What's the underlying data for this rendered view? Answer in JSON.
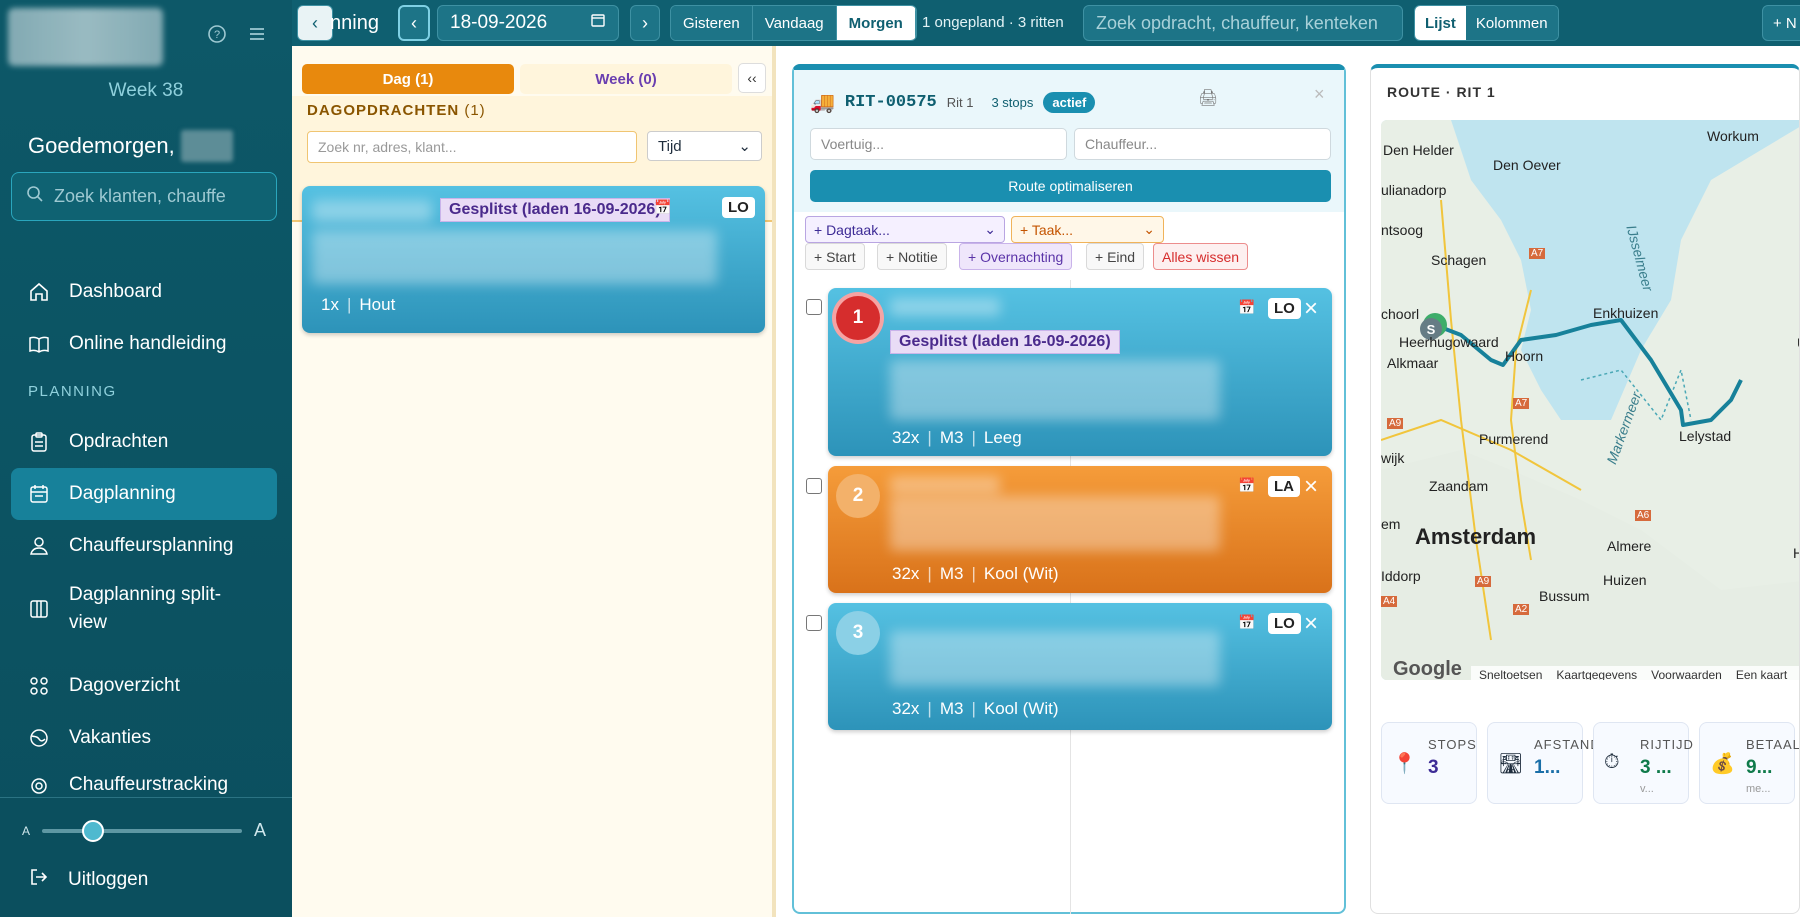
{
  "sidebar": {
    "week": "Week 38",
    "greeting": "Goedemorgen,",
    "search_placeholder": "Zoek klanten, chauffe",
    "section": "PLANNING",
    "nav": [
      {
        "label": "Dashboard",
        "icon": "home-icon"
      },
      {
        "label": "Online handleiding",
        "icon": "book-icon"
      },
      {
        "label": "Opdrachten",
        "icon": "clipboard-icon"
      },
      {
        "label": "Dagplanning",
        "icon": "calendar-icon",
        "active": true
      },
      {
        "label": "Chauffeursplanning",
        "icon": "drivers-icon"
      },
      {
        "label": "Dagplanning split-view",
        "icon": "split-view-icon"
      },
      {
        "label": "Dagoverzicht",
        "icon": "grid-icon"
      },
      {
        "label": "Vakanties",
        "icon": "globe-icon"
      },
      {
        "label": "Chauffeurstracking",
        "icon": "pin-icon"
      }
    ],
    "font_small": "A",
    "font_large": "A",
    "logout": "Uitloggen"
  },
  "topbar": {
    "title": "nning",
    "date": "18-09-2026",
    "day_buttons": [
      "Gisteren",
      "Vandaag",
      "Morgen"
    ],
    "active_day": "Morgen",
    "status": "1 ongepland · 3 ritten",
    "search_placeholder": "Zoek opdracht, chauffeur, kenteken",
    "views": [
      "Lijst",
      "Kolommen"
    ],
    "active_view": "Lijst",
    "new_label": "+ N"
  },
  "dagopdrachten": {
    "tab_day": "Dag (1)",
    "tab_week": "Week (0)",
    "collapse": "‹‹",
    "title": "DAGOPDRACHTEN",
    "count": "(1)",
    "search_placeholder": "Zoek nr, adres, klant...",
    "sort": "Tijd",
    "card": {
      "split": "Gesplitst (laden 16-09-2026)",
      "badge": "LO",
      "qty": "1x",
      "product": "Hout"
    }
  },
  "rit": {
    "code": "RIT-00575",
    "name": "Rit 1",
    "stops": "3 stops",
    "status": "actief",
    "vehicle_placeholder": "Voertuig...",
    "driver_placeholder": "Chauffeur...",
    "optimize": "Route optimaliseren",
    "dagtaak": "+ Dagtaak...",
    "taak": "+ Taak...",
    "chips": [
      "+ Start",
      "+ Notitie",
      "+ Overnachting",
      "+ Eind",
      "Alles wissen"
    ],
    "stops_list": [
      {
        "num": "1",
        "badge": "LO",
        "split": "Gesplitst (laden 16-09-2026)",
        "qty": "32x",
        "unit": "M3",
        "product": "Leeg"
      },
      {
        "num": "2",
        "badge": "LA",
        "qty": "32x",
        "unit": "M3",
        "product": "Kool (Wit)"
      },
      {
        "num": "3",
        "badge": "LO",
        "qty": "32x",
        "unit": "M3",
        "product": "Kool (Wit)"
      }
    ]
  },
  "route": {
    "title": "ROUTE · RIT 1",
    "map_labels": [
      "Den Helder",
      "Den Oever",
      "Workum",
      "ulianadorp",
      "ntsoog",
      "Schagen",
      "IJsselmeer",
      "Enkhuizen",
      "choorl",
      "Heerhugowaard",
      "Alkmaar",
      "Hoorn",
      "Purmerend",
      "Markermeer",
      "Lelystad",
      "wijk",
      "Zaandam",
      "Amsterdam",
      "Almere",
      "Huizen",
      "Bussum",
      "Iddorp",
      "em",
      "Ha",
      "U"
    ],
    "road_labels": [
      "A7",
      "A7",
      "A9",
      "A6",
      "A9",
      "A2",
      "A4"
    ],
    "start_marker": "S",
    "map_footer": [
      "Sneltoetsen",
      "Kaartgegevens",
      "Voorwaarden",
      "Een kaart"
    ],
    "google": "Google",
    "kpis": [
      {
        "label": "STOPS",
        "value": "3",
        "sub": "",
        "color": "#3d2b96"
      },
      {
        "label": "AFSTAND",
        "value": "1...",
        "sub": "",
        "color": "#1a6fa8"
      },
      {
        "label": "RIJTIJD",
        "value": "3 ...",
        "sub": "v...",
        "color": "#0f7a4a"
      },
      {
        "label": "BETAAL",
        "value": "9...",
        "sub": "me...",
        "color": "#0f7a4a"
      }
    ]
  }
}
